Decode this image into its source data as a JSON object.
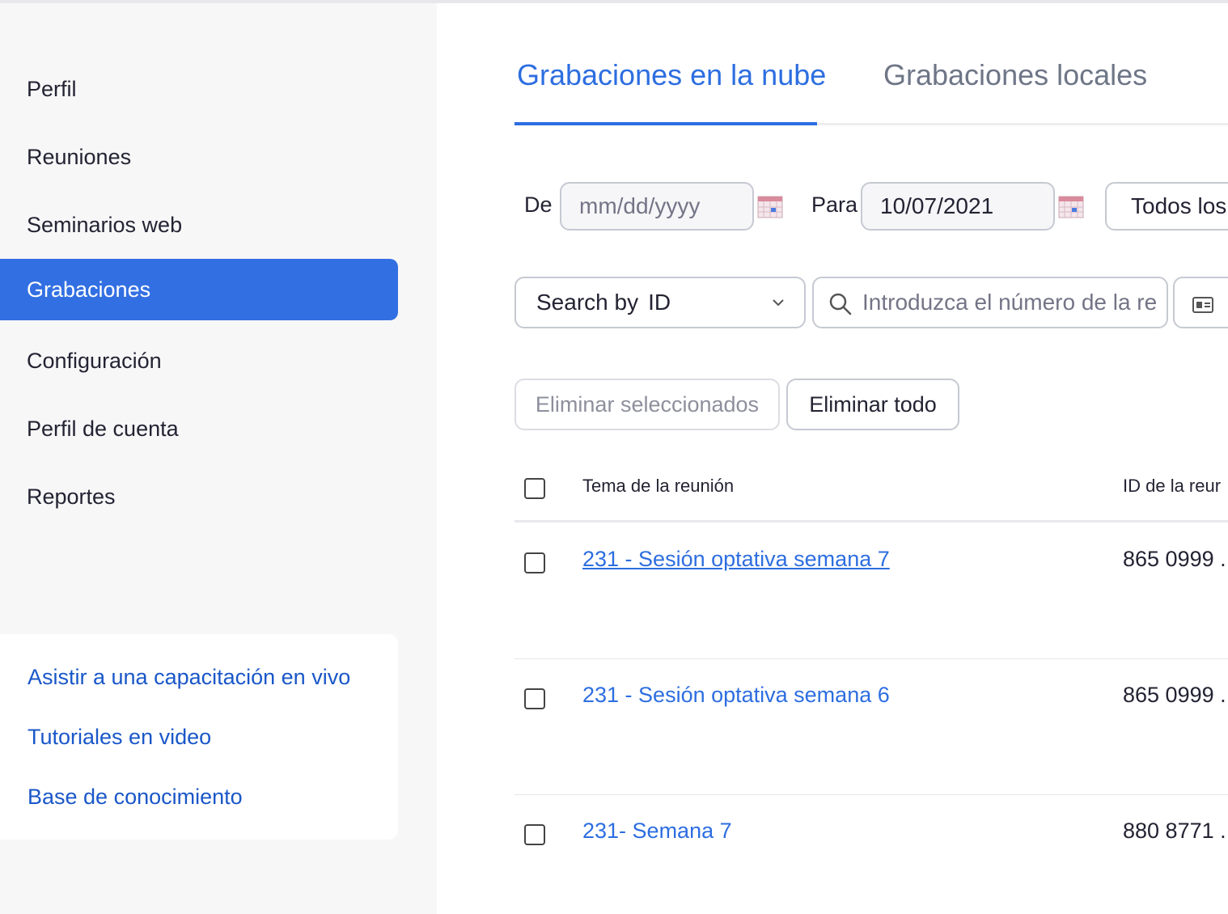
{
  "sidebar": {
    "items": [
      {
        "label": "Perfil",
        "active": false
      },
      {
        "label": "Reuniones",
        "active": false
      },
      {
        "label": "Seminarios web",
        "active": false
      },
      {
        "label": "Grabaciones",
        "active": true
      },
      {
        "label": "Configuración",
        "active": false
      },
      {
        "label": "Perfil de cuenta",
        "active": false
      },
      {
        "label": "Reportes",
        "active": false
      }
    ],
    "help_links": [
      "Asistir a una capacitación en vivo",
      "Tutoriales en video",
      "Base de conocimiento"
    ]
  },
  "tabs": [
    {
      "label": "Grabaciones en la nube",
      "active": true
    },
    {
      "label": "Grabaciones locales",
      "active": false
    }
  ],
  "filters": {
    "from_label": "De",
    "from_placeholder": "mm/dd/yyyy",
    "to_label": "Para",
    "to_value": "10/07/2021",
    "type_select": "Todos los"
  },
  "search": {
    "by_label": "Search by",
    "by_value": "ID",
    "placeholder": "Introduzca el número de la re"
  },
  "actions": {
    "delete_selected": "Eliminar seleccionados",
    "delete_all": "Eliminar todo"
  },
  "table": {
    "headers": {
      "topic": "Tema de la reunión",
      "id": "ID de la reur"
    },
    "rows": [
      {
        "topic": "231 - Sesión optativa semana 7",
        "id": "865 0999 ."
      },
      {
        "topic": "231 - Sesión optativa semana 6",
        "id": "865 0999 ."
      },
      {
        "topic": "231- Semana 7",
        "id": "880 8771 ."
      }
    ]
  },
  "colors": {
    "accent": "#326fe2",
    "link": "#1a57c8",
    "tab_active": "#2d6ee0",
    "tab_inactive": "#6e7687"
  }
}
